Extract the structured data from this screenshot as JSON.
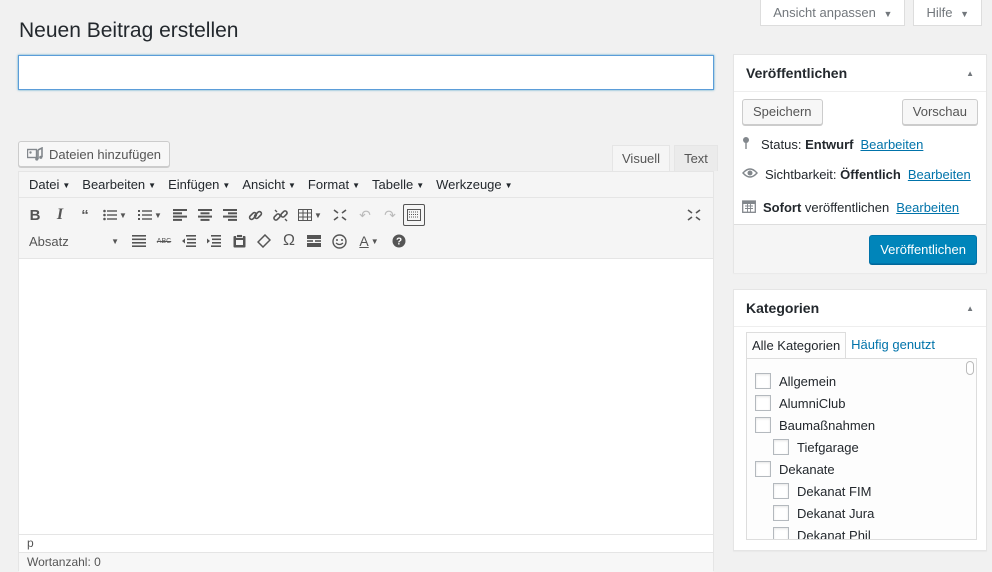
{
  "header": {
    "screen_options_label": "Ansicht anpassen",
    "help_label": "Hilfe",
    "page_title": "Neuen Beitrag erstellen"
  },
  "title_input": {
    "value": "",
    "placeholder": ""
  },
  "media": {
    "add_media_label": "Dateien hinzufügen"
  },
  "editor": {
    "tabs": [
      "Visuell",
      "Text"
    ],
    "active_tab": "Visuell",
    "menu": [
      "Datei",
      "Bearbeiten",
      "Einfügen",
      "Ansicht",
      "Format",
      "Tabelle",
      "Werkzeuge"
    ],
    "format_select": "Absatz",
    "path": "p",
    "word_count": "Wortanzahl: 0"
  },
  "publish": {
    "title": "Veröffentlichen",
    "save_label": "Speichern",
    "preview_label": "Vorschau",
    "status_label": "Status:",
    "status_value": "Entwurf",
    "visibility_label": "Sichtbarkeit:",
    "visibility_value": "Öffentlich",
    "schedule_value": "Sofort",
    "schedule_label": "veröffentlichen",
    "edit_label": "Bearbeiten",
    "publish_label": "Veröffentlichen"
  },
  "categories": {
    "title": "Kategorien",
    "tab_all": "Alle Kategorien",
    "tab_popular": "Häufig genutzt",
    "items": [
      {
        "label": "Allgemein",
        "level": 0
      },
      {
        "label": "AlumniClub",
        "level": 0
      },
      {
        "label": "Baumaßnahmen",
        "level": 0
      },
      {
        "label": "Tiefgarage",
        "level": 1
      },
      {
        "label": "Dekanate",
        "level": 0
      },
      {
        "label": "Dekanat FIM",
        "level": 1
      },
      {
        "label": "Dekanat Jura",
        "level": 1
      },
      {
        "label": "Dekanat Phil",
        "level": 1
      }
    ]
  },
  "colors": {
    "background": "#f1f1f1",
    "link": "#0073aa",
    "primary_button": "#0085ba",
    "focus_border": "#5b9dd9"
  }
}
